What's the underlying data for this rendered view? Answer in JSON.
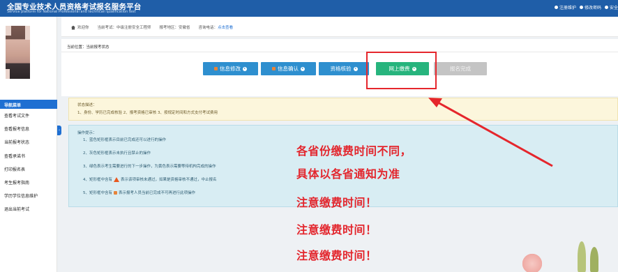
{
  "header": {
    "title": "全国专业技术人员资格考试报名服务平台",
    "subtitle": "Service platform for National Professional and technican qualification test",
    "links": [
      "注册维护",
      "修改密码",
      "安全"
    ]
  },
  "sidebar": {
    "nav_title": "导航菜单",
    "items": [
      "查看考试文件",
      "查看报考信息",
      "当前报考状态",
      "查看承诺书",
      "打印报名表",
      "考生报考指南",
      "学历学位信息维护",
      "退出当前考试"
    ]
  },
  "infobar": {
    "welcome": "欢迎你",
    "current_exam": "当前考试：中级注册安全工程师",
    "region": "报考地区：安徽省",
    "phone_label": "咨询电话：",
    "phone_link": "点击查看"
  },
  "breadcrumb": "当前位置：当前报考状态",
  "steps": {
    "edit": "信息修改",
    "confirm": "信息确认",
    "verify": "资格核验",
    "pay": "网上缴费",
    "done": "报名完成"
  },
  "status": {
    "title": "状态描述：",
    "text": "1、身份、学历已完成核验 2、报考资格已审核 3、按规定时间和方式支付考试费用"
  },
  "tips": {
    "title": "操作提示：",
    "items": [
      "1、蓝色矩形框表示目前已完成还可以进行的操作",
      "2、灰色矩形框表示未执行且禁止的操作",
      "3、绿色表示考生需要进行的下一步操作，为黄色表示需要等待机构完成的操作",
      "4、矩形框中含有",
      "表示该项审核未通过，如果是资格审核不通过，中止报名",
      "5、矩形框中含有",
      "表示报考人员当前已完成不可再进行此项操作"
    ]
  },
  "notice": [
    "各省份缴费时间不同，",
    "具体以各省通知为准",
    "注意缴费时间！",
    "注意缴费时间！",
    "注意缴费时间！"
  ],
  "colors": {
    "header_blue": "#1f5ea8",
    "button_blue": "#2e8fcf",
    "button_green": "#27b47d",
    "button_gray": "#c4c4c4",
    "annotation_red": "#e3262d"
  }
}
